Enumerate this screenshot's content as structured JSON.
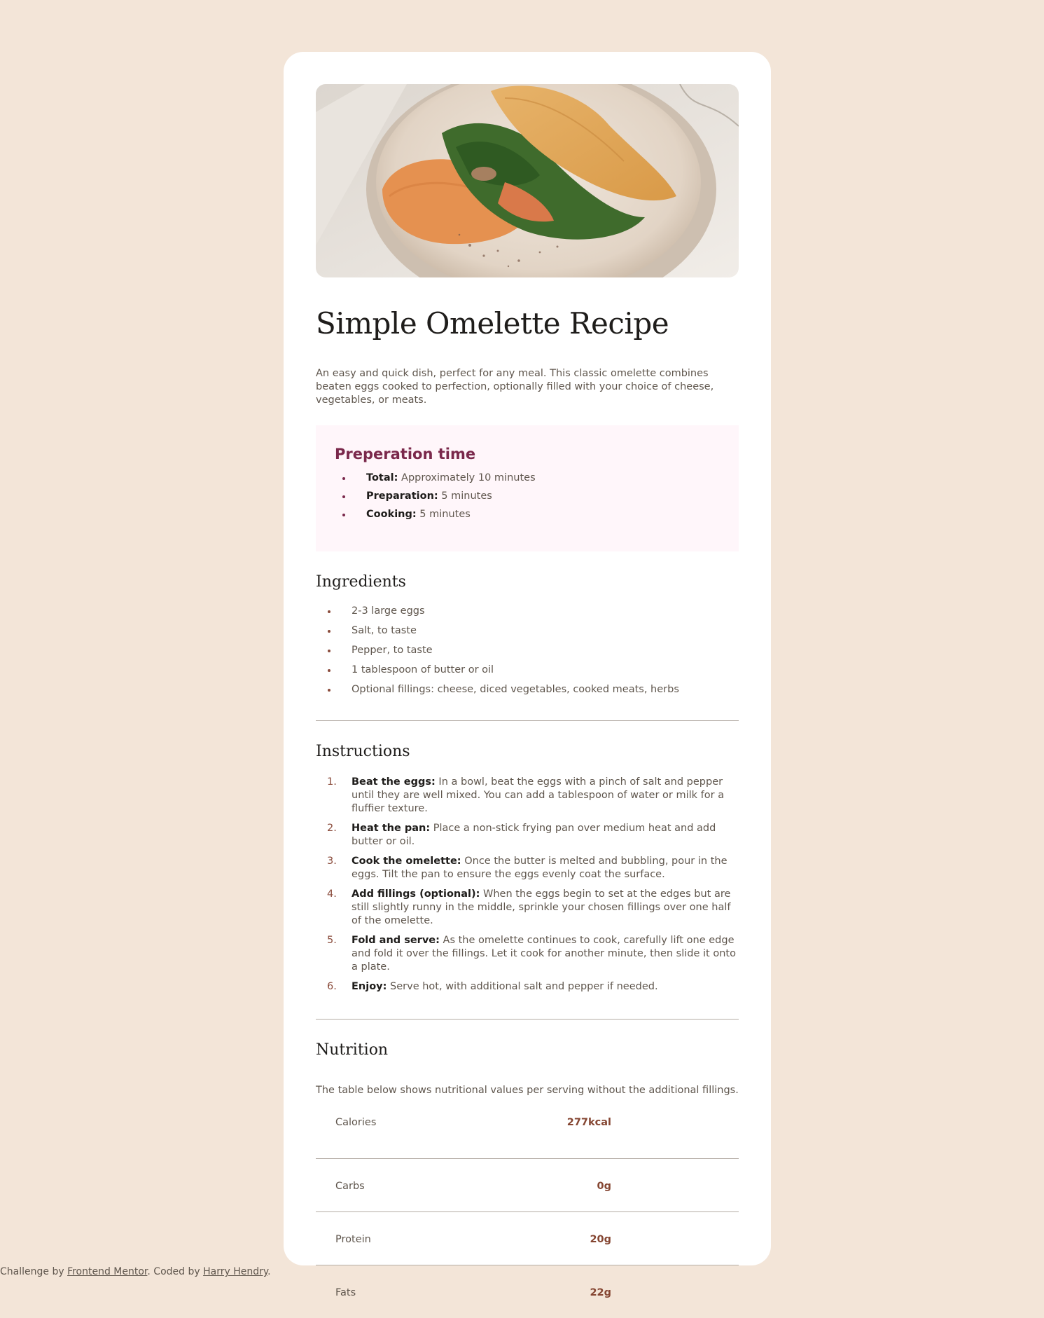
{
  "recipe": {
    "title": "Simple Omelette Recipe",
    "intro": "An easy and quick dish, perfect for any meal. This classic omelette combines beaten eggs cooked to perfection, optionally filled with your choice of cheese, vegetables, or meats.",
    "image_alt": "omelette-photo"
  },
  "prep": {
    "title": "Preperation time",
    "items": [
      {
        "label": "Total:",
        "text": " Approximately 10 minutes"
      },
      {
        "label": "Preparation:",
        "text": " 5 minutes"
      },
      {
        "label": "Cooking:",
        "text": " 5 minutes"
      }
    ]
  },
  "ingredients": {
    "title": "Ingredients",
    "items": [
      "2-3 large eggs",
      "Salt, to taste",
      "Pepper, to taste",
      "1 tablespoon of butter or oil",
      "Optional fillings: cheese, diced vegetables, cooked meats, herbs"
    ]
  },
  "instructions": {
    "title": "Instructions",
    "steps": [
      {
        "n": "1.",
        "label": "Beat the eggs:",
        "text": " In a bowl, beat the eggs with a pinch of salt and pepper until they are well mixed. You can add a tablespoon of water or milk for a fluffier texture."
      },
      {
        "n": "2.",
        "label": "Heat the pan:",
        "text": " Place a non-stick frying pan over medium heat and add butter or oil."
      },
      {
        "n": "3.",
        "label": "Cook the omelette:",
        "text": " Once the butter is melted and bubbling, pour in the eggs. Tilt the pan to ensure the eggs evenly coat the surface."
      },
      {
        "n": "4.",
        "label": "Add fillings (optional):",
        "text": " When the eggs begin to set at the edges but are still slightly runny in the middle, sprinkle your chosen fillings over one half of the omelette."
      },
      {
        "n": "5.",
        "label": "Fold and serve:",
        "text": " As the omelette continues to cook, carefully lift one edge and fold it over the fillings. Let it cook for another minute, then slide it onto a plate."
      },
      {
        "n": "6.",
        "label": "Enjoy:",
        "text": " Serve hot, with additional salt and pepper if needed."
      }
    ]
  },
  "nutrition": {
    "title": "Nutrition",
    "description": "The table below shows nutritional values per serving without the additional fillings.",
    "rows": [
      {
        "label": "Calories",
        "value": "277kcal"
      },
      {
        "label": "Carbs",
        "value": "0g"
      },
      {
        "label": "Protein",
        "value": "20g"
      },
      {
        "label": "Fats",
        "value": "22g"
      }
    ]
  },
  "footer": {
    "prefix": "Challenge by ",
    "link1": "Frontend Mentor",
    "middle": ". Coded by ",
    "link2": "Harry Hendry",
    "suffix": "."
  },
  "colors": {
    "background": "#f3e5d8",
    "card": "#ffffff",
    "accent_rose": "#7a284b",
    "accent_brown": "#854632",
    "prep_bg": "#fff6fa"
  }
}
